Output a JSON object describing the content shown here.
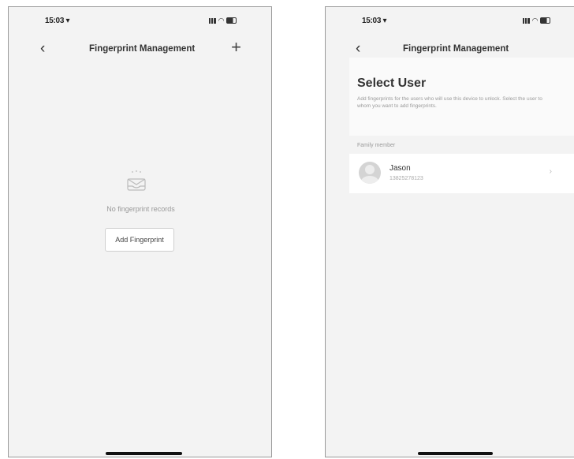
{
  "left_screen": {
    "status": {
      "time": "15:03 ▾"
    },
    "nav": {
      "back": "‹",
      "title": "Fingerprint Management",
      "add": "+"
    },
    "empty": {
      "message": "No fingerprint records",
      "add_button": "Add Fingerprint"
    }
  },
  "right_screen": {
    "status": {
      "time": "15:03 ▾"
    },
    "nav": {
      "back": "‹",
      "title": "Fingerprint Management"
    },
    "header": {
      "title": "Select User",
      "description": "Add fingerprints for the users who will use this device to unlock. Select the user to whom you want to add fingerprints."
    },
    "section_label": "Family member",
    "users": [
      {
        "name": "Jason",
        "phone": "13825278123",
        "arrow": "›"
      }
    ]
  }
}
